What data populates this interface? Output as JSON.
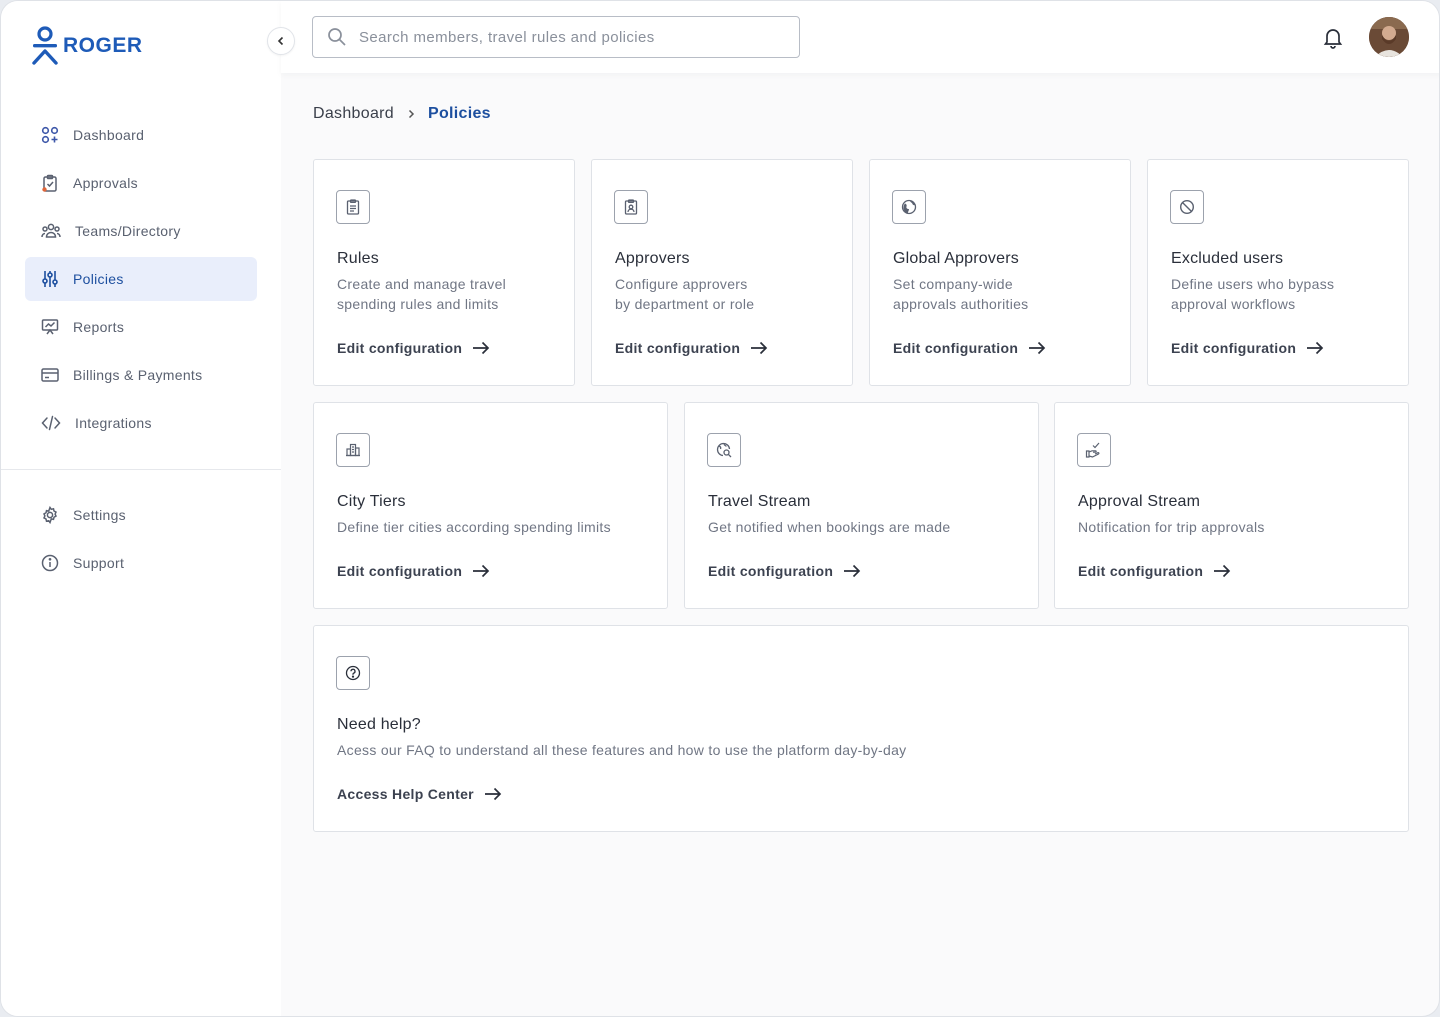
{
  "app": {
    "logo_text": "ROGER"
  },
  "search": {
    "placeholder": "Search members, travel rules and policies"
  },
  "sidebar": {
    "main_items": [
      {
        "label": "Dashboard",
        "icon": "dashboard-icon"
      },
      {
        "label": "Approvals",
        "icon": "clipboard-check-icon"
      },
      {
        "label": "Teams/Directory",
        "icon": "team-icon"
      },
      {
        "label": "Policies",
        "icon": "sliders-icon",
        "active": true
      },
      {
        "label": "Reports",
        "icon": "presentation-chart-icon"
      },
      {
        "label": "Billings & Payments",
        "icon": "credit-card-icon"
      },
      {
        "label": "Integrations",
        "icon": "code-icon"
      }
    ],
    "bottom_items": [
      {
        "label": "Settings",
        "icon": "gear-icon"
      },
      {
        "label": "Support",
        "icon": "info-icon"
      }
    ]
  },
  "breadcrumb": {
    "home": "Dashboard",
    "current": "Policies"
  },
  "cards": [
    {
      "title": "Rules",
      "desc_1": "Create and manage travel",
      "desc_2": "spending rules and limits",
      "link": "Edit configuration",
      "icon": "clipboard-list-icon"
    },
    {
      "title": "Approvers",
      "desc_1": "Configure approvers",
      "desc_2": "by department or role",
      "link": "Edit configuration",
      "icon": "id-badge-icon"
    },
    {
      "title": "Global Approvers",
      "desc_1": "Set company-wide",
      "desc_2": "approvals authorities",
      "link": "Edit configuration",
      "icon": "globe-icon"
    },
    {
      "title": "Excluded users",
      "desc_1": "Define users who bypass",
      "desc_2": "approval workflows",
      "link": "Edit configuration",
      "icon": "ban-icon"
    },
    {
      "title": "City Tiers",
      "desc_1": "Define tier cities according spending limits",
      "link": "Edit configuration",
      "icon": "city-buildings-icon"
    },
    {
      "title": "Travel Stream",
      "desc_1": "Get notified when bookings are made",
      "link": "Edit configuration",
      "icon": "globe-search-icon"
    },
    {
      "title": "Approval Stream",
      "desc_1": "Notification for trip approvals",
      "link": "Edit configuration",
      "icon": "hand-check-icon"
    }
  ],
  "help": {
    "title": "Need help?",
    "desc": "Acess our FAQ to understand all these features and how to use the platform day-by-day",
    "link": "Access Help Center",
    "icon": "question-circle-icon"
  },
  "colors": {
    "brand": "#1e5bb8",
    "active_bg": "#e9eefb",
    "active_text": "#1d4f9f"
  }
}
